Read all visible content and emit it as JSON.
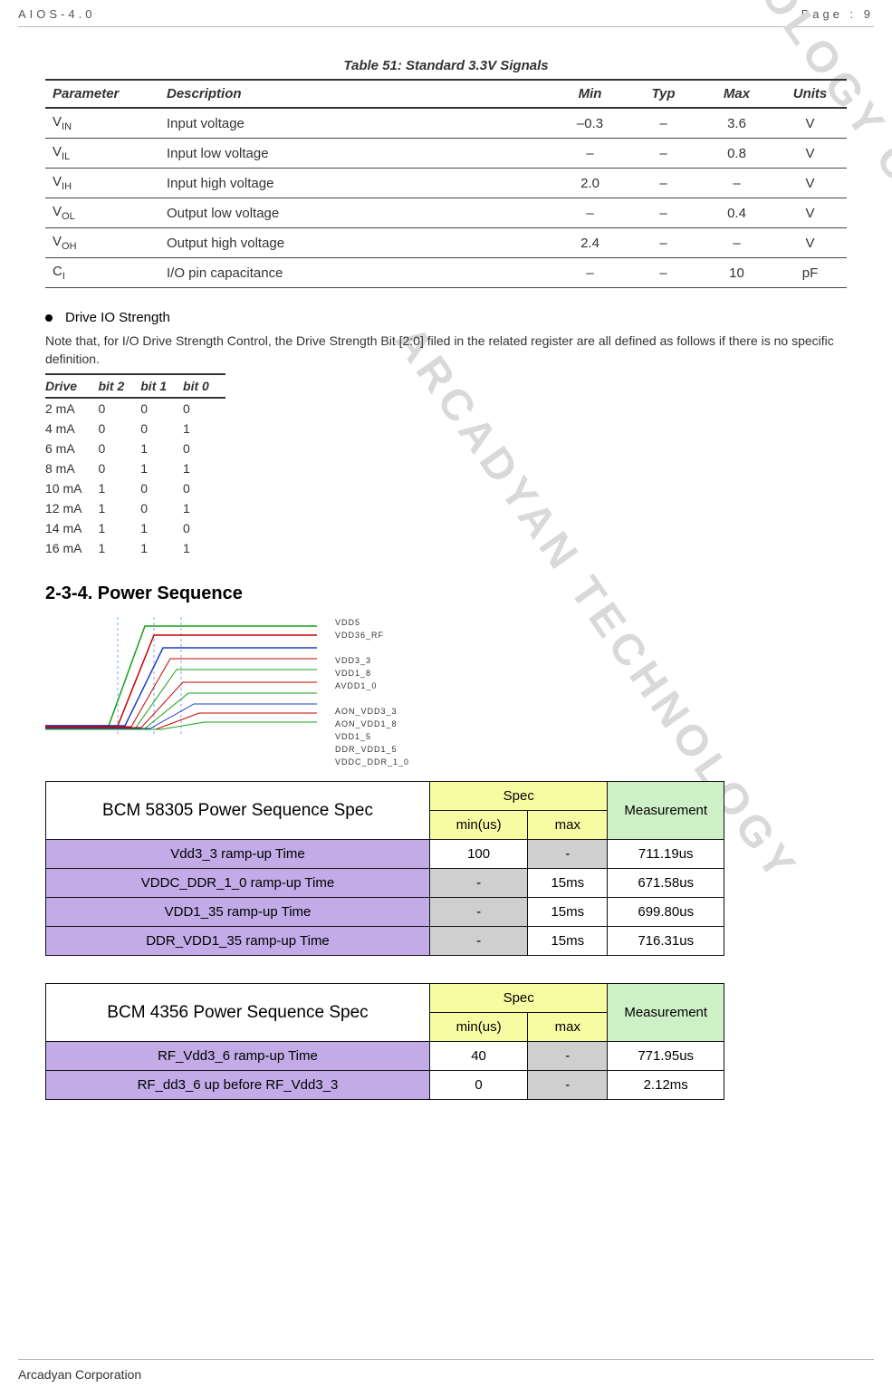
{
  "header": {
    "left": "AIOS-4.0",
    "right": "Page : 9"
  },
  "footer": {
    "company": "Arcadyan Corporation"
  },
  "watermarks": {
    "line1": "TECHNOLOGY CORPORATION",
    "line2": "ARCADYAN TECHNOLOGY"
  },
  "table51": {
    "title": "Table 51:  Standard 3.3V Signals",
    "headers": [
      "Parameter",
      "Description",
      "Min",
      "Typ",
      "Max",
      "Units"
    ],
    "rows": [
      {
        "param": "V",
        "sub": "IN",
        "desc": "Input voltage",
        "min": "–0.3",
        "typ": "–",
        "max": "3.6",
        "units": "V"
      },
      {
        "param": "V",
        "sub": "IL",
        "desc": "Input low voltage",
        "min": "–",
        "typ": "–",
        "max": "0.8",
        "units": "V"
      },
      {
        "param": "V",
        "sub": "IH",
        "desc": "Input high voltage",
        "min": "2.0",
        "typ": "–",
        "max": "–",
        "units": "V"
      },
      {
        "param": "V",
        "sub": "OL",
        "desc": "Output low voltage",
        "min": "–",
        "typ": "–",
        "max": "0.4",
        "units": "V"
      },
      {
        "param": "V",
        "sub": "OH",
        "desc": "Output high voltage",
        "min": "2.4",
        "typ": "–",
        "max": "–",
        "units": "V"
      },
      {
        "param": "C",
        "sub": "I",
        "desc": "I/O pin capacitance",
        "min": "–",
        "typ": "–",
        "max": "10",
        "units": "pF"
      }
    ]
  },
  "bullet": {
    "label": "Drive IO Strength"
  },
  "drive_note": "Note that, for I/O Drive Strength Control, the Drive Strength Bit [2:0] filed in the related register are all defined as follows if there is no specific definition.",
  "drive_table": {
    "headers": [
      "Drive",
      "bit 2",
      "bit 1",
      "bit 0"
    ],
    "rows": [
      {
        "d": "2 mA",
        "b2": "0",
        "b1": "0",
        "b0": "0"
      },
      {
        "d": "4 mA",
        "b2": "0",
        "b1": "0",
        "b0": "1"
      },
      {
        "d": "6 mA",
        "b2": "0",
        "b1": "1",
        "b0": "0"
      },
      {
        "d": "8 mA",
        "b2": "0",
        "b1": "1",
        "b0": "1"
      },
      {
        "d": "10 mA",
        "b2": "1",
        "b1": "0",
        "b0": "0"
      },
      {
        "d": "12 mA",
        "b2": "1",
        "b1": "0",
        "b0": "1"
      },
      {
        "d": "14 mA",
        "b2": "1",
        "b1": "1",
        "b0": "0"
      },
      {
        "d": "16 mA",
        "b2": "1",
        "b1": "1",
        "b0": "1"
      }
    ]
  },
  "section_heading": "2-3-4. Power Sequence",
  "wave_labels": [
    "VDD5",
    "VDD36_RF",
    "",
    "VDD3_3",
    "VDD1_8",
    "AVDD1_0",
    "",
    "AON_VDD3_3",
    "AON_VDD1_8",
    "VDD1_5",
    "DDR_VDD1_5",
    "VDDC_DDR_1_0"
  ],
  "bcm58305": {
    "title": "BCM 58305 Power Sequence Spec",
    "spec_label": "Spec",
    "meas_label": "Measurement",
    "min_label": "min(us)",
    "max_label": "max",
    "rows": [
      {
        "name": "Vdd3_3 ramp-up Time",
        "min": "100",
        "max": "-",
        "meas": "711.19us",
        "min_grey": false,
        "max_grey": true
      },
      {
        "name": "VDDC_DDR_1_0 ramp-up Time",
        "min": "-",
        "max": "15ms",
        "meas": "671.58us",
        "min_grey": true,
        "max_grey": false
      },
      {
        "name": "VDD1_35 ramp-up Time",
        "min": "-",
        "max": "15ms",
        "meas": "699.80us",
        "min_grey": true,
        "max_grey": false
      },
      {
        "name": "DDR_VDD1_35 ramp-up Time",
        "min": "-",
        "max": "15ms",
        "meas": "716.31us",
        "min_grey": true,
        "max_grey": false
      }
    ]
  },
  "bcm4356": {
    "title": "BCM 4356 Power Sequence Spec",
    "spec_label": "Spec",
    "meas_label": "Measurement",
    "min_label": "min(us)",
    "max_label": "max",
    "rows": [
      {
        "name": "RF_Vdd3_6 ramp-up Time",
        "min": "40",
        "max": "-",
        "meas": "771.95us",
        "min_grey": false,
        "max_grey": true
      },
      {
        "name": "RF_dd3_6 up before RF_Vdd3_3",
        "min": "0",
        "max": "-",
        "meas": "2.12ms",
        "min_grey": false,
        "max_grey": true
      }
    ]
  }
}
